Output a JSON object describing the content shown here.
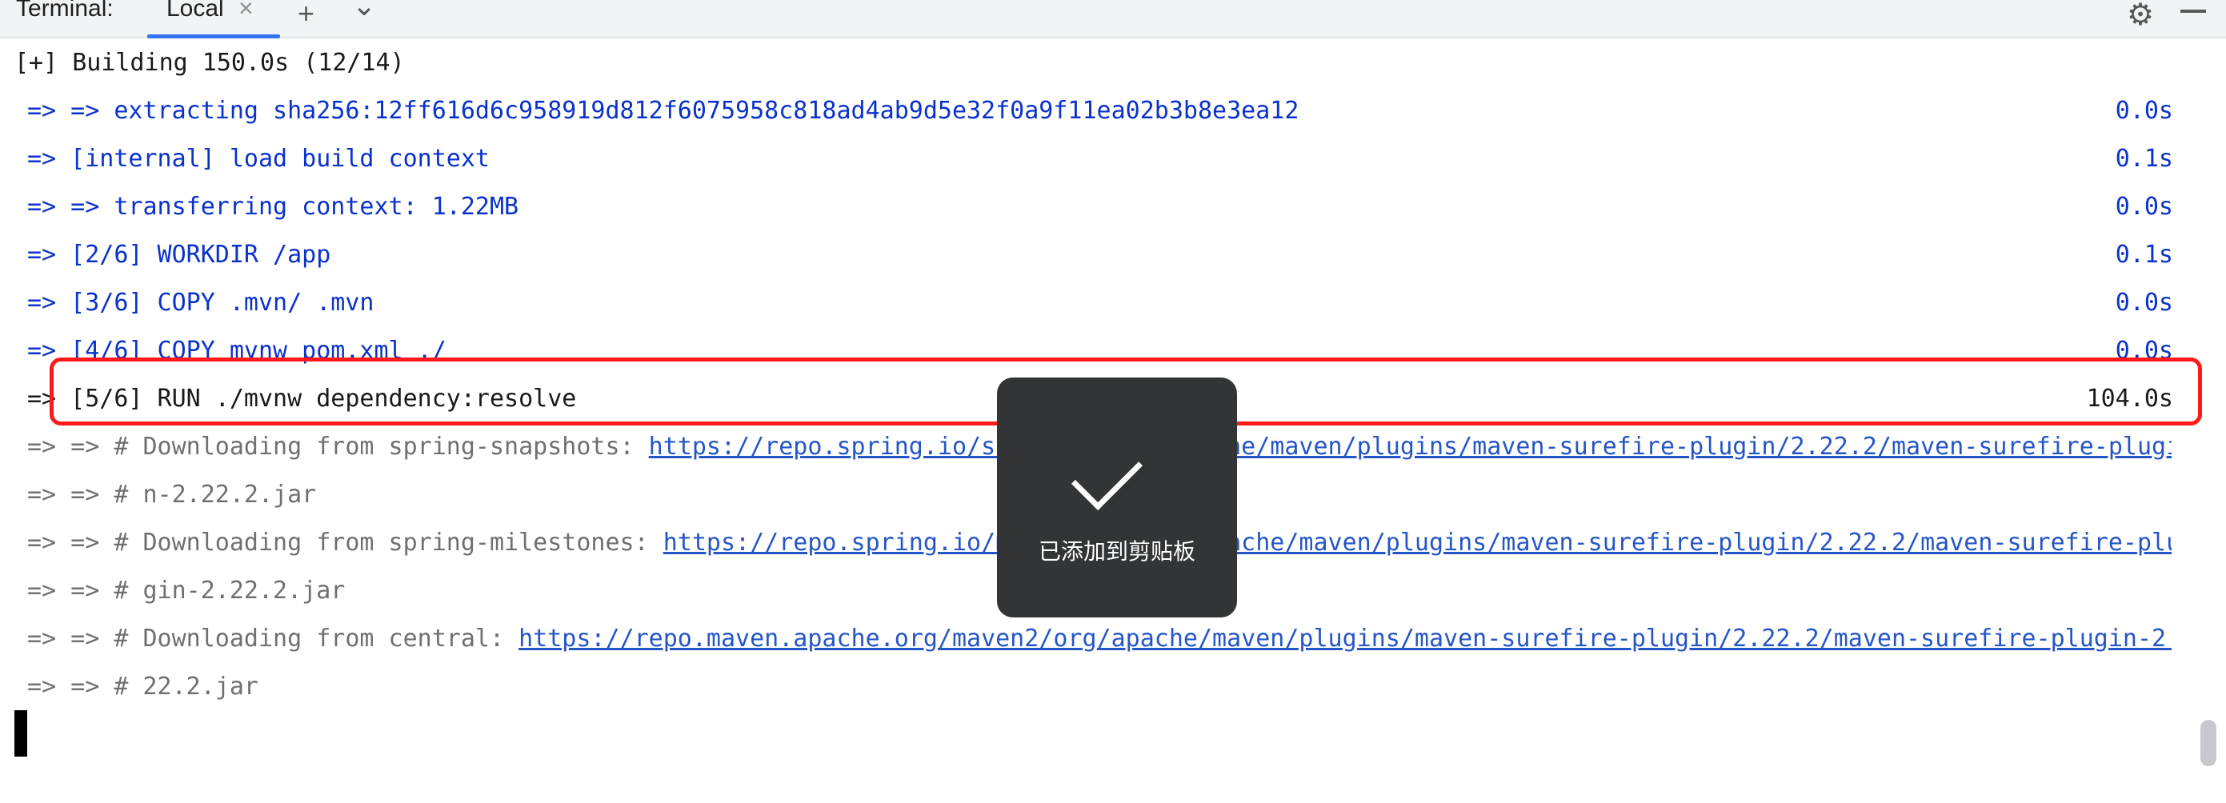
{
  "tabbar": {
    "title": "Terminal:",
    "tab_local": "Local",
    "close_glyph": "×",
    "add_glyph": "+",
    "dropdown_glyph": "⌄",
    "settings_icon": "gear-icon",
    "minimize_icon": "minimize-icon"
  },
  "terminal": {
    "header": "[+] Building 150.0s (12/14)",
    "lines": [
      {
        "text": "=> => extracting sha256:12ff616d6c958919d812f6075958c818ad4ab9d5e32f0a9f11ea02b3b8e3ea12",
        "time": "0.0s"
      },
      {
        "text": "=> [internal] load build context",
        "time": "0.1s"
      },
      {
        "text": "=> => transferring context: 1.22MB",
        "time": "0.0s"
      },
      {
        "text": "=> [2/6] WORKDIR /app",
        "time": "0.1s"
      },
      {
        "text": "=> [3/6] COPY .mvn/ .mvn",
        "time": "0.0s"
      },
      {
        "text": "=> [4/6] COPY mvnw pom.xml ./",
        "time": "0.0s"
      },
      {
        "text": "=> [5/6] RUN ./mvnw dependency:resolve",
        "time": "104.0s"
      }
    ],
    "log": [
      {
        "prefix": "=> => # Downloading from spring-snapshots: ",
        "url": "https://repo.spring.io/snapshot/org/apache/maven/plugins/maven-surefire-plugin/2.22.2/maven-surefire-plugi"
      },
      {
        "prefix": "=> => # n-2.22.2.jar",
        "url": ""
      },
      {
        "prefix": "=> => # Downloading from spring-milestones: ",
        "url": "https://repo.spring.io/milestone/org/apache/maven/plugins/maven-surefire-plugin/2.22.2/maven-surefire-plu"
      },
      {
        "prefix": "=> => # gin-2.22.2.jar",
        "url": ""
      },
      {
        "prefix": "=> => # Downloading from central: ",
        "url": "https://repo.maven.apache.org/maven2/org/apache/maven/plugins/maven-surefire-plugin/2.22.2/maven-surefire-plugin-2."
      },
      {
        "prefix": "=> => # 22.2.jar",
        "url": ""
      }
    ]
  },
  "toast": {
    "icon": "check-icon",
    "message": "已添加到剪贴板"
  },
  "colors": {
    "step_blue": "#0a32cc",
    "log_gray": "#6f7073",
    "link_blue": "#2556c7",
    "highlight_red": "#ff1a1a",
    "toast_bg": "#333436"
  }
}
